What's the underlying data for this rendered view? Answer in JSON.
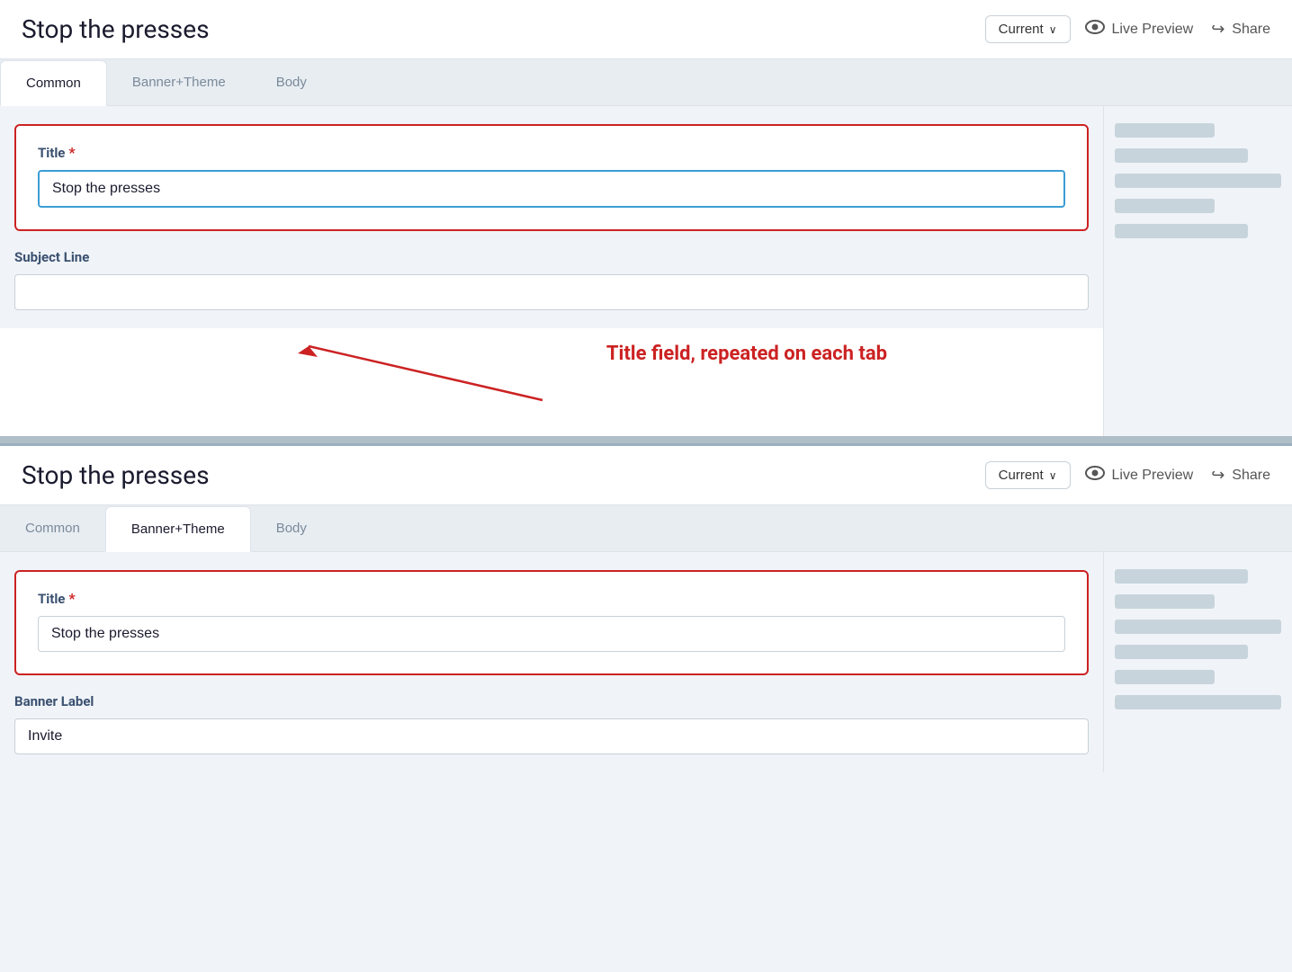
{
  "panel1": {
    "header": {
      "title": "Stop the presses",
      "version_label": "Current",
      "version_chevron": "∨",
      "live_preview_label": "Live Preview",
      "share_label": "Share"
    },
    "tabs": [
      {
        "id": "common",
        "label": "Common",
        "active": true
      },
      {
        "id": "banner_theme",
        "label": "Banner+Theme",
        "active": false
      },
      {
        "id": "body",
        "label": "Body",
        "active": false
      }
    ],
    "form": {
      "title_label": "Title",
      "title_required": "*",
      "title_value": "Stop the presses",
      "subject_line_label": "Subject Line",
      "subject_line_value": ""
    }
  },
  "annotation": {
    "text": "Title field, repeated on each tab"
  },
  "panel2": {
    "header": {
      "title": "Stop the presses",
      "version_label": "Current",
      "version_chevron": "∨",
      "live_preview_label": "Live Preview",
      "share_label": "Share"
    },
    "tabs": [
      {
        "id": "common",
        "label": "Common",
        "active": false
      },
      {
        "id": "banner_theme",
        "label": "Banner+Theme",
        "active": true
      },
      {
        "id": "body",
        "label": "Body",
        "active": false
      }
    ],
    "form": {
      "title_label": "Title",
      "title_required": "*",
      "title_value": "Stop the presses",
      "banner_label": "Banner Label",
      "banner_value": "Invite"
    }
  },
  "sidebar1": {
    "lines": [
      "short",
      "medium",
      "long",
      "short",
      "medium"
    ]
  },
  "sidebar2": {
    "lines": [
      "medium",
      "short",
      "long",
      "medium",
      "short",
      "long"
    ]
  }
}
